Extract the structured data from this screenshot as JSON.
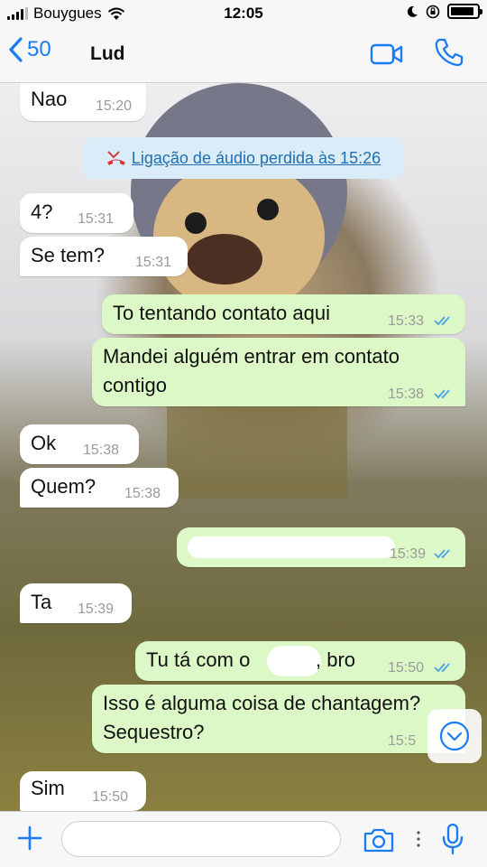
{
  "status_bar": {
    "carrier": "Bouygues",
    "time": "12:05",
    "battery_level": 0.9
  },
  "header": {
    "back_count": "50",
    "contact_name": "Lud"
  },
  "system_message": {
    "text": "Ligação de áudio perdida às 15:26"
  },
  "messages": [
    {
      "direction": "in",
      "lines": [
        "Nao"
      ],
      "time": "15:20"
    },
    {
      "direction": "in",
      "lines": [
        "4?"
      ],
      "time": "15:31"
    },
    {
      "direction": "in",
      "lines": [
        "Se tem?"
      ],
      "time": "15:31"
    },
    {
      "direction": "out",
      "lines": [
        "To tentando contato aqui"
      ],
      "time": "15:33"
    },
    {
      "direction": "out",
      "lines": [
        "Mandei alguém entrar em contato",
        "contigo"
      ],
      "time": "15:38"
    },
    {
      "direction": "in",
      "lines": [
        "Ok"
      ],
      "time": "15:38"
    },
    {
      "direction": "in",
      "lines": [
        "Quem?"
      ],
      "time": "15:38"
    },
    {
      "direction": "out",
      "lines": [
        ""
      ],
      "time": "15:39"
    },
    {
      "direction": "in",
      "lines": [
        "Ta"
      ],
      "time": "15:39"
    },
    {
      "direction": "out",
      "lines": [
        "Tu tá com o",
        ", bro"
      ],
      "time": "15:50"
    },
    {
      "direction": "out",
      "lines": [
        "Isso é alguma coisa de chantagem?",
        "Sequestro?"
      ],
      "time": "15:5"
    },
    {
      "direction": "in",
      "lines": [
        "Sim"
      ],
      "time": "15:50"
    }
  ],
  "colors": {
    "accent": "#1a7cf5",
    "outgoing_bubble": "#dcf8c6",
    "incoming_bubble": "#ffffff",
    "read_ticks": "#4fa3e8",
    "missed_call": "#d9363e"
  }
}
